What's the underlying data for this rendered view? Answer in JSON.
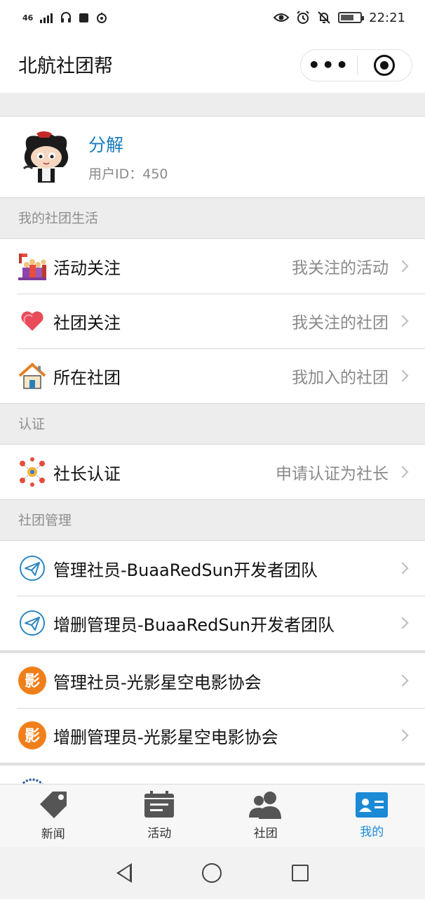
{
  "status_bar": {
    "network": "46",
    "time": "22:21"
  },
  "nav": {
    "title": "北航社团帮",
    "more_label": "•••"
  },
  "profile": {
    "name": "分解",
    "user_id": "用户ID：450"
  },
  "sections": {
    "my_club_life": "我的社团生活",
    "certification": "认证",
    "club_management": "社团管理"
  },
  "club_life_items": [
    {
      "label": "活动关注",
      "value": "我关注的活动",
      "icon": "event-crowd-icon"
    },
    {
      "label": "社团关注",
      "value": "我关注的社团",
      "icon": "heart-icon"
    },
    {
      "label": "所在社团",
      "value": "我加入的社团",
      "icon": "house-icon"
    }
  ],
  "cert_items": [
    {
      "label": "社长认证",
      "value": "申请认证为社长",
      "icon": "leader-network-icon"
    }
  ],
  "manage_items": [
    {
      "label": "管理社员-BuaaRedSun开发者团队",
      "icon": "paper-plane-icon"
    },
    {
      "label": "增删管理员-BuaaRedSun开发者团队",
      "icon": "paper-plane-icon"
    },
    {
      "label": "管理社员-光影星空电影协会",
      "icon": "film-logo-icon"
    },
    {
      "label": "增删管理员-光影星空电影协会",
      "icon": "film-logo-icon"
    }
  ],
  "tabs": [
    {
      "label": "新闻",
      "icon": "tag-icon"
    },
    {
      "label": "活动",
      "icon": "calendar-icon"
    },
    {
      "label": "社团",
      "icon": "people-icon"
    },
    {
      "label": "我的",
      "icon": "profile-card-icon",
      "active": true
    }
  ],
  "colors": {
    "accent": "#1a8ad6",
    "profile_name": "#1a7bbf",
    "film_logo": "#f07f1a"
  }
}
